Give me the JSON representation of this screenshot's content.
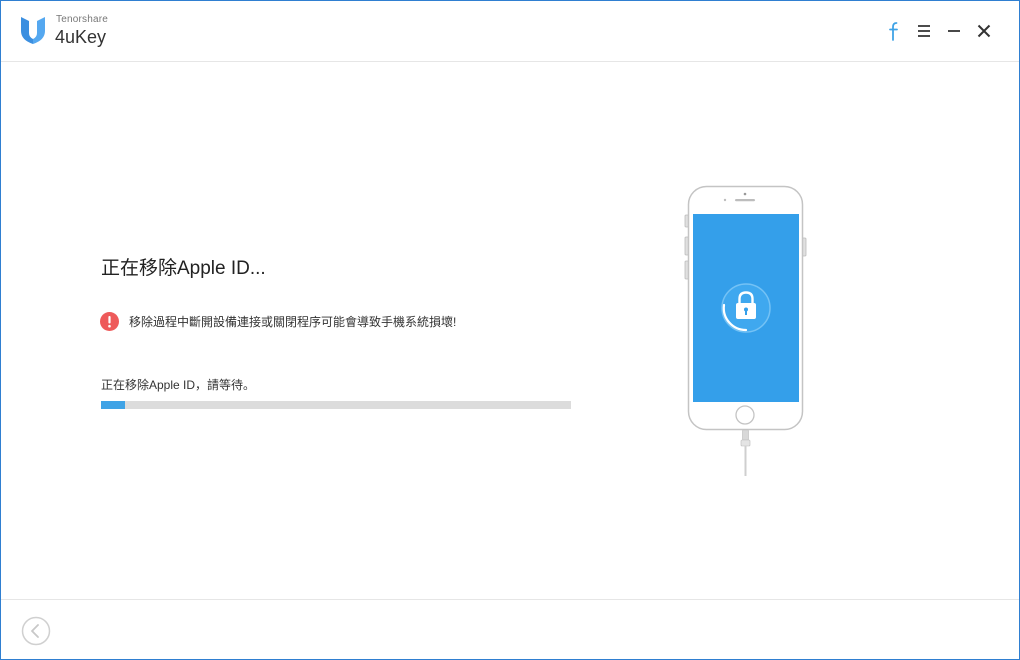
{
  "app": {
    "brand_small": "Tenorshare",
    "brand_name": "4uKey"
  },
  "window_controls": {
    "facebook_icon": "facebook-icon",
    "menu_icon": "menu-icon",
    "minimize_icon": "minimize-icon",
    "close_icon": "close-icon"
  },
  "main": {
    "title": "正在移除Apple ID...",
    "warning_text": "移除過程中斷開設備連接或關閉程序可能會導致手機系統損壞!",
    "progress_label": "正在移除Apple ID，請等待。",
    "progress_fraction": 0.05
  },
  "illustration": {
    "icon": "lock-icon"
  },
  "footer": {
    "back_icon": "back-arrow-icon"
  },
  "colors": {
    "accent": "#3fa3e6",
    "window_border": "#2f7fd1",
    "screen_blue": "#349fea",
    "warning_red": "#ee5a5a",
    "track": "#dcdcdc"
  }
}
